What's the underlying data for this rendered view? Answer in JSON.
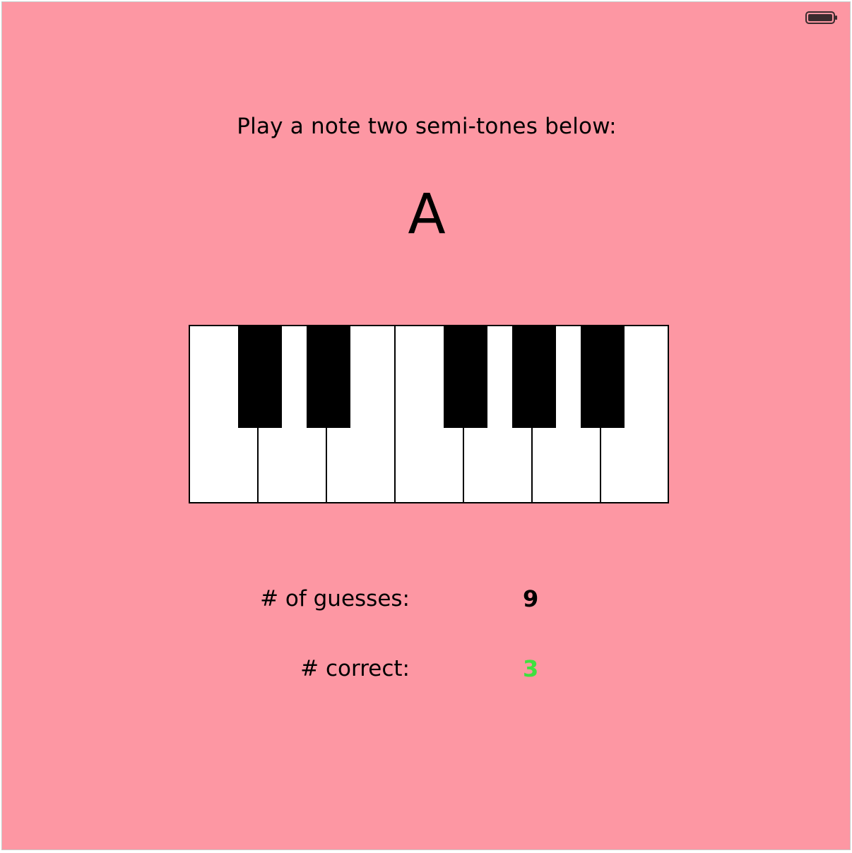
{
  "status_bar": {
    "battery_icon": "battery-full-icon"
  },
  "prompt": {
    "text": "Play a note two semi-tones below:"
  },
  "target_note": {
    "value": "A"
  },
  "piano": {
    "white_keys": 7,
    "black_keys": 5
  },
  "stats": {
    "guesses_label": "# of guesses:",
    "guesses_value": "9",
    "correct_label": "# correct:",
    "correct_value": "3"
  },
  "colors": {
    "background": "#fd97a3",
    "correct_value": "#3fe03f",
    "text": "#000000"
  }
}
